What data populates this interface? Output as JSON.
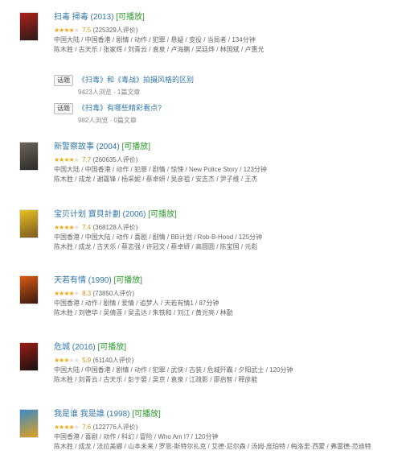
{
  "playable_label": "[可播放]",
  "movies": [
    {
      "title": "扫毒 掃毒 (2013)",
      "stars": 4,
      "score": "7.5",
      "votes": "(225329人评价)",
      "meta1": "中国大陆 / 中国香港 / 剧情 / 动作 / 犯罪 / 悬疑 / 变役 / 当局者 / 134分钟",
      "meta2": "陈木胜 / 古天乐 / 张家辉 / 刘青云 / 袁泉 / 卢海鹏 / 吴廷烨 / 林国斌 / 卢惠光",
      "poster_colors": [
        "#b0201a",
        "#2a1a18"
      ]
    },
    {
      "title": "新警察故事 (2004)",
      "stars": 4,
      "score": "7.7",
      "votes": "(260635人评价)",
      "meta1": "中国大陆 / 中国香港 / 动作 / 犯罪 / 剧情 / 惊悚 / New Police Story / 123分钟",
      "meta2": "陈木胜 / 成龙 / 谢霆锋 / 杨采妮 / 蔡卓妍 / 吴彦祖 / 安志杰 / 尹子维 / 王杰",
      "poster_colors": [
        "#6a6458",
        "#2c2a28"
      ]
    },
    {
      "title": "宝贝计划 寶貝計劃 (2006)",
      "stars": 4,
      "score": "7.4",
      "votes": "(368128人评价)",
      "meta1": "中国香港 / 中国大陆 / 动作 / 喜剧 / 剧情 / BB计划 / Rob-B-Hood / 125分钟",
      "meta2": "陈木胜 / 成龙 / 古天乐 / 蔡志强 / 许冠文 / 蔡卓妍 / 高圆圆 / 陈宝国 / 元彪",
      "poster_colors": [
        "#e8c020",
        "#7a5a20"
      ]
    },
    {
      "title": "天若有情 (1990)",
      "stars": 4,
      "score": "8.3",
      "votes": "(73850人评价)",
      "meta1": "中国香港 / 动作 / 剧情 / 爱情 / 追梦人 / 天若有情1 / 87分钟",
      "meta2": "陈木胜 / 刘德华 / 吴倩莲 / 吴孟达 / 朱铁和 / 刘江 / 黄光亮 / 林勤",
      "poster_colors": [
        "#d85a10",
        "#3a1a10"
      ]
    },
    {
      "title": "危城 (2016)",
      "stars": 3,
      "score": "5.9",
      "votes": "(61140人评价)",
      "meta1": "中国大陆 / 中国香港 / 剧情 / 动作 / 犯罪 / 武侠 / 古装 / 危城歼霸 / 夕阳武士 / 120分钟",
      "meta2": "陈木胜 / 刘青云 / 古天乐 / 彭于晏 / 吴京 / 袁泉 / 江疏影 / 廖启智 / 释彦能",
      "poster_colors": [
        "#9a1c14",
        "#1a1210"
      ]
    },
    {
      "title": "我是谁 我是誰 (1998)",
      "stars": 4,
      "score": "7.6",
      "votes": "(122776人评价)",
      "meta1": "中国香港 / 喜剧 / 动作 / 科幻 / 冒险 / Who Am I? / 120分钟",
      "meta2": "陈木胜 / 成龙 / 法拉美娜 / 山本未来 / 罗恩·斯特尔扎克 / 艾德·尼尔森 / 汤姆·庞珀特 / 梅洛里·西蒙 / 弗雷德·范迪特",
      "poster_colors": [
        "#3a8ac8",
        "#e0a020"
      ]
    }
  ],
  "topics": [
    {
      "tag": "话题",
      "title": "《扫毒》和《毒战》拍摄风格的区别",
      "stats": "9423人浏览 · 1篇文章"
    },
    {
      "tag": "话题",
      "title": "《扫毒》有哪些精彩看点?",
      "stats": "982人浏览 · 0篇文章"
    }
  ]
}
